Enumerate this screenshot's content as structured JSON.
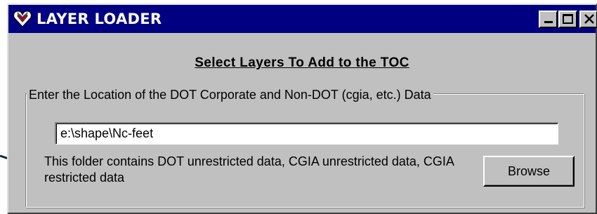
{
  "window": {
    "title": "LAYER LOADER",
    "controls": [
      "minimize-icon",
      "maximize-icon",
      "close-icon"
    ]
  },
  "main": {
    "heading": "Select Layers To Add to the TOC",
    "group_label": "Enter the Location of the DOT Corporate and Non-DOT (cgia, etc.) Data",
    "path_value": "e:\\shape\\Nc-feet",
    "info_text": "This folder contains DOT unrestricted data, CGIA unrestricted data, CGIA restricted data",
    "browse_label": "Browse"
  },
  "colors": {
    "titlebar": "#000080",
    "face": "#c0c0c0",
    "annotation_arrow": "#1a2540"
  }
}
